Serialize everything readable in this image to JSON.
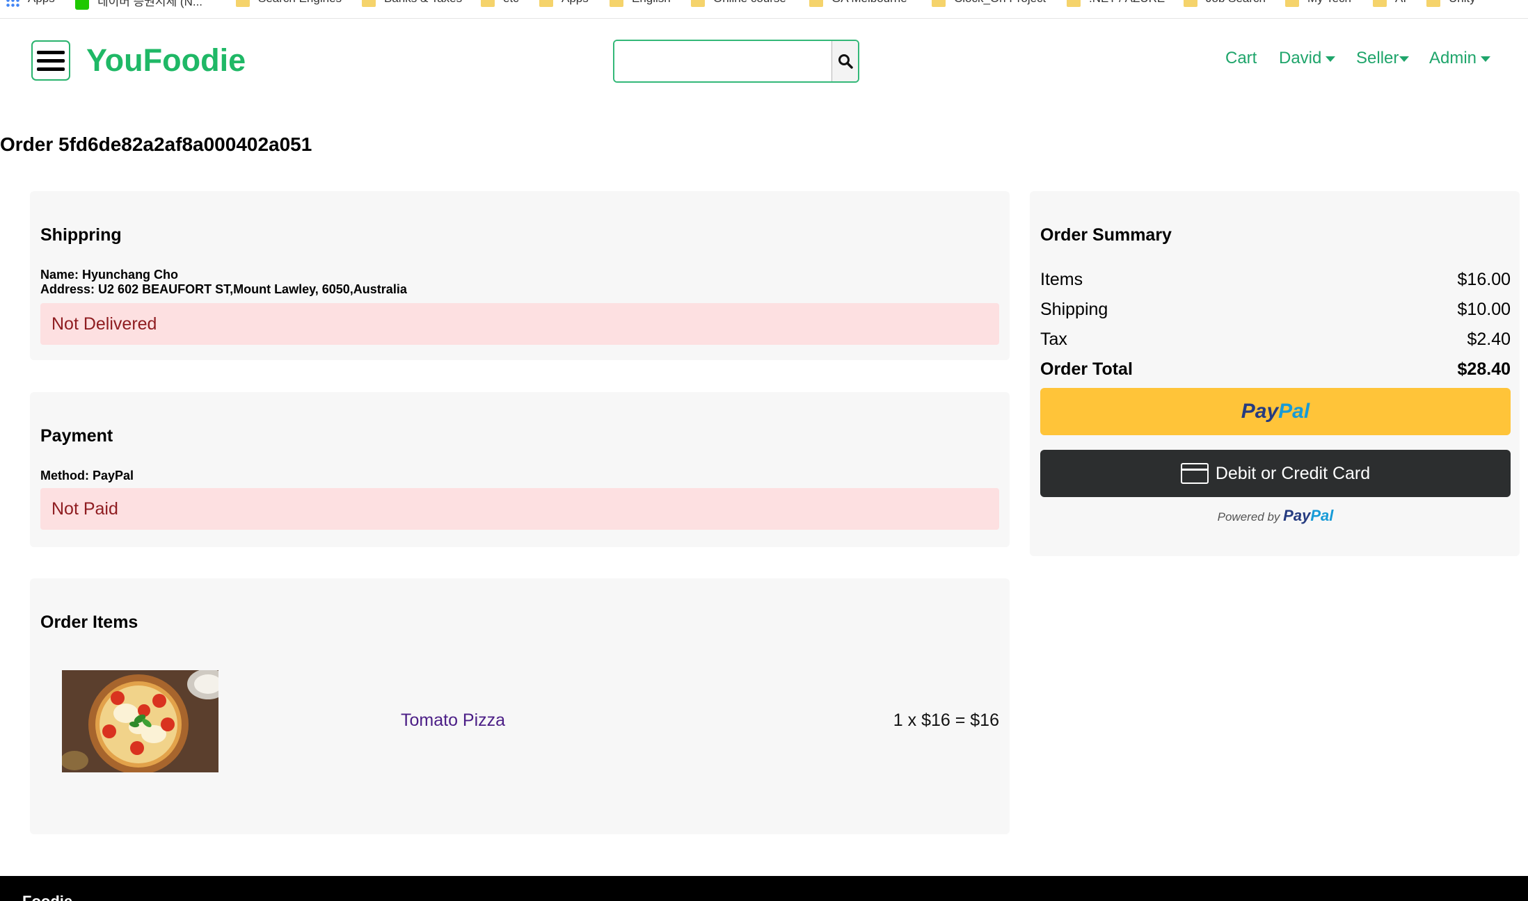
{
  "bookmarks": [
    {
      "label": "Apps",
      "icon": "apps-grid-icon"
    },
    {
      "label": "네이버 증권시세 (N...",
      "icon": "naver-icon"
    },
    {
      "label": "Search Engines",
      "icon": "folder-icon"
    },
    {
      "label": "Banks & Taxes",
      "icon": "folder-icon"
    },
    {
      "label": "etc",
      "icon": "folder-icon"
    },
    {
      "label": "Apps",
      "icon": "folder-icon"
    },
    {
      "label": "English",
      "icon": "folder-icon"
    },
    {
      "label": "Online course",
      "icon": "folder-icon"
    },
    {
      "label": "GA Melbourne",
      "icon": "folder-icon"
    },
    {
      "label": "Clock_On Project",
      "icon": "folder-icon"
    },
    {
      "label": ".NET / AZURE",
      "icon": "folder-icon"
    },
    {
      "label": "Job Search",
      "icon": "folder-icon"
    },
    {
      "label": "My Tech",
      "icon": "folder-icon"
    },
    {
      "label": "AI",
      "icon": "folder-icon"
    },
    {
      "label": "Unity",
      "icon": "folder-icon"
    }
  ],
  "header": {
    "brand": "YouFoodie",
    "search_placeholder": "",
    "nav": {
      "cart": "Cart",
      "user": "David",
      "seller": "Seller",
      "admin": "Admin"
    }
  },
  "order": {
    "title": "Order 5fd6de82a2af8a000402a051",
    "shipping": {
      "heading": "Shippring",
      "name_label": "Name:",
      "name": "Hyunchang Cho",
      "address_label": "Address:",
      "address": "U2 602 BEAUFORT ST,Mount Lawley, 6050,Australia",
      "status": "Not Delivered"
    },
    "payment": {
      "heading": "Payment",
      "method_label": "Method:",
      "method": "PayPal",
      "status": "Not Paid"
    },
    "items": {
      "heading": "Order Items",
      "list": [
        {
          "name": "Tomato Pizza",
          "price_line": "1 x $16 = $16"
        }
      ]
    }
  },
  "summary": {
    "heading": "Order Summary",
    "rows": [
      {
        "label": "Items",
        "value": "$16.00"
      },
      {
        "label": "Shipping",
        "value": "$10.00"
      },
      {
        "label": "Tax",
        "value": "$2.40"
      },
      {
        "label": "Order Total",
        "value": "$28.40"
      }
    ],
    "paypal_button": {
      "part1": "Pay",
      "part2": "Pal"
    },
    "card_button": "Debit or Credit Card",
    "powered_by": "Powered by",
    "powered_logo": {
      "part1": "Pay",
      "part2": "Pal"
    }
  },
  "footer": {
    "text": "Foodie"
  },
  "colors": {
    "brand_green": "#1fb866",
    "alert_bg": "#fde0e1",
    "alert_text": "#8f1d21",
    "paypal_yellow": "#ffc439",
    "card_dark": "#2c2e2f",
    "paypal_navy": "#253b80",
    "paypal_blue": "#179bd7"
  }
}
